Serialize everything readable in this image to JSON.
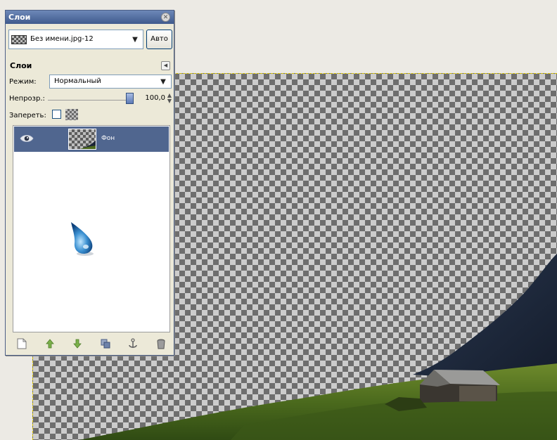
{
  "dialog": {
    "title": "Слои",
    "image_name": "Без имени.jpg-12",
    "auto_button": "Авто",
    "section_title": "Слои",
    "mode_label": "Режим:",
    "mode_value": "Нормальный",
    "opacity_label": "Непрозр.:",
    "opacity_value": "100,0",
    "opacity_fraction": 1.0,
    "lock_label": "Запереть:",
    "lock_checked": false,
    "layers": [
      {
        "name": "Фон",
        "visible": true,
        "selected": true
      }
    ],
    "bottom_tools": [
      "new-layer-icon",
      "raise-layer-icon",
      "lower-layer-icon",
      "duplicate-layer-icon",
      "anchor-layer-icon",
      "delete-layer-icon"
    ]
  },
  "colors": {
    "titlebar": "#3f5a8d",
    "selection_row": "#50668f",
    "dialog_bg": "#ece9d8",
    "workspace_bg": "#eceae4"
  }
}
